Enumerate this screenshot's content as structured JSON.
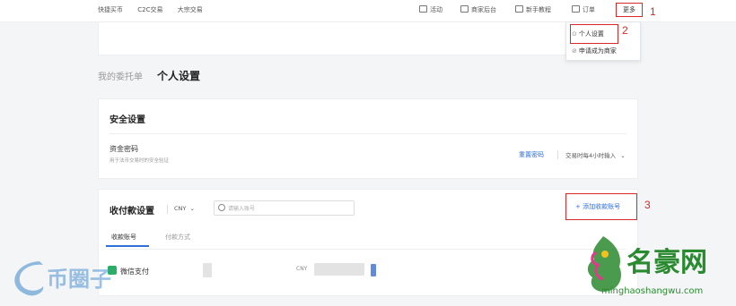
{
  "topnav": {
    "left": [
      "快捷买币",
      "C2C交易",
      "大宗交易"
    ],
    "right": [
      {
        "label": "活动",
        "icon": "gift-icon"
      },
      {
        "label": "商家后台",
        "icon": "store-icon"
      },
      {
        "label": "新手教程",
        "icon": "video-icon"
      },
      {
        "label": "订单",
        "icon": "order-icon"
      }
    ],
    "more": "更多"
  },
  "dropdown": {
    "items": [
      "个人设置",
      "申请成为商家"
    ]
  },
  "annotations": [
    "1",
    "2",
    "3"
  ],
  "tabs": {
    "inactive": "我的委托单",
    "active": "个人设置"
  },
  "security": {
    "title": "安全设置",
    "fund_password_label": "资金密码",
    "fund_password_desc": "用于法币交易时的安全验证",
    "reset_link": "重置密码",
    "verify_option": "交易时每4小时输入"
  },
  "payment": {
    "title": "收付款设置",
    "currency": "CNY",
    "search_placeholder": "请输入账号",
    "add_button": "+ 添加收款账号",
    "subtabs": [
      "收款账号",
      "付款方式"
    ],
    "row": {
      "method": "微信支付",
      "currency": "CNY"
    }
  },
  "watermarks": {
    "left_text": "币圈子",
    "right_cn": "名豪网",
    "right_url": "minghaoshangwu.com"
  },
  "colors": {
    "annotation_red": "#d62a2a",
    "link_blue": "#2f6fd6",
    "wechat_green": "#2aae67",
    "watermark_green": "#2a8a2f"
  }
}
